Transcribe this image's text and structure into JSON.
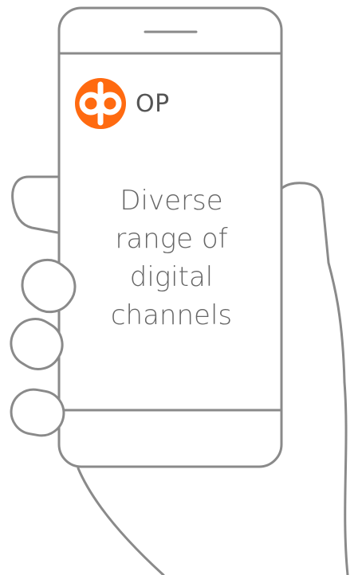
{
  "brand": {
    "logo_icon": "op-logo-icon",
    "name": "OP",
    "accent_color": "#ff6a10"
  },
  "screen": {
    "headline_lines": [
      "Diverse",
      "range of",
      "digital",
      "channels"
    ]
  },
  "colors": {
    "outline": "#8a8a8a",
    "text": "#666666"
  }
}
